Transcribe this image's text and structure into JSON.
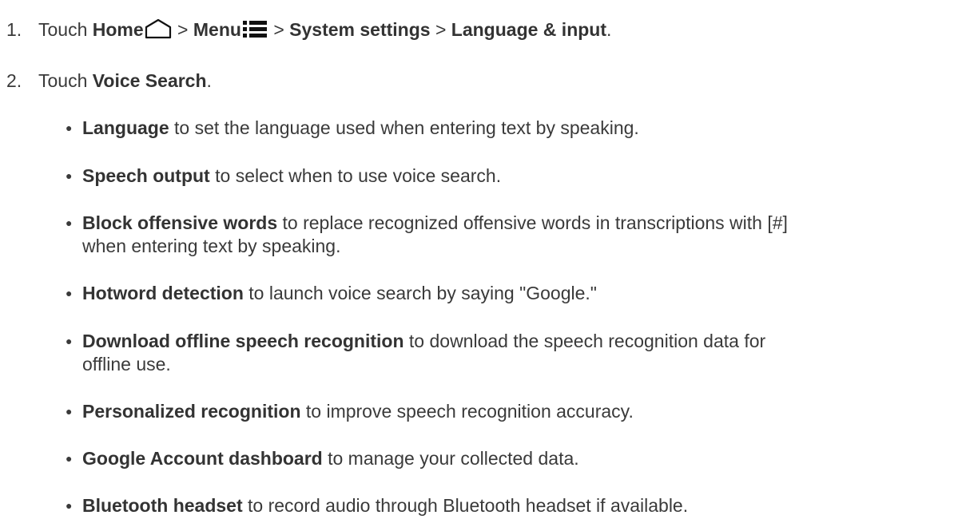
{
  "steps": [
    {
      "number": "1.",
      "prefix": "Touch ",
      "home": "Home",
      "sep1": " > ",
      "menu": "Menu",
      "sep2": " > ",
      "system_settings": "System settings",
      "sep3": " > ",
      "language_input": "Language & input",
      "end": "."
    },
    {
      "number": "2.",
      "prefix": "Touch ",
      "voice_search": "Voice Search",
      "end": "."
    }
  ],
  "bullets": [
    {
      "bold": "Language",
      "text": " to set the language used when entering text by speaking."
    },
    {
      "bold": "Speech output",
      "text": " to select when to use voice search."
    },
    {
      "bold": "Block offensive words",
      "text": " to replace recognized offensive words in transcriptions with [#]",
      "text2": "when entering text by speaking."
    },
    {
      "bold": "Hotword detection",
      "text": " to launch voice search by saying \"Google.\""
    },
    {
      "bold": "Download offline speech recognition",
      "text": " to download the speech recognition data for",
      "text2": "offline use."
    },
    {
      "bold": "Personalized recognition",
      "text": " to improve speech recognition accuracy."
    },
    {
      "bold": "Google Account dashboard",
      "text": " to manage your collected data."
    },
    {
      "bold": "Bluetooth headset",
      "text": " to record audio through Bluetooth headset if available."
    }
  ],
  "icons": {
    "home": "home-outline-icon",
    "menu": "menu-list-icon"
  }
}
